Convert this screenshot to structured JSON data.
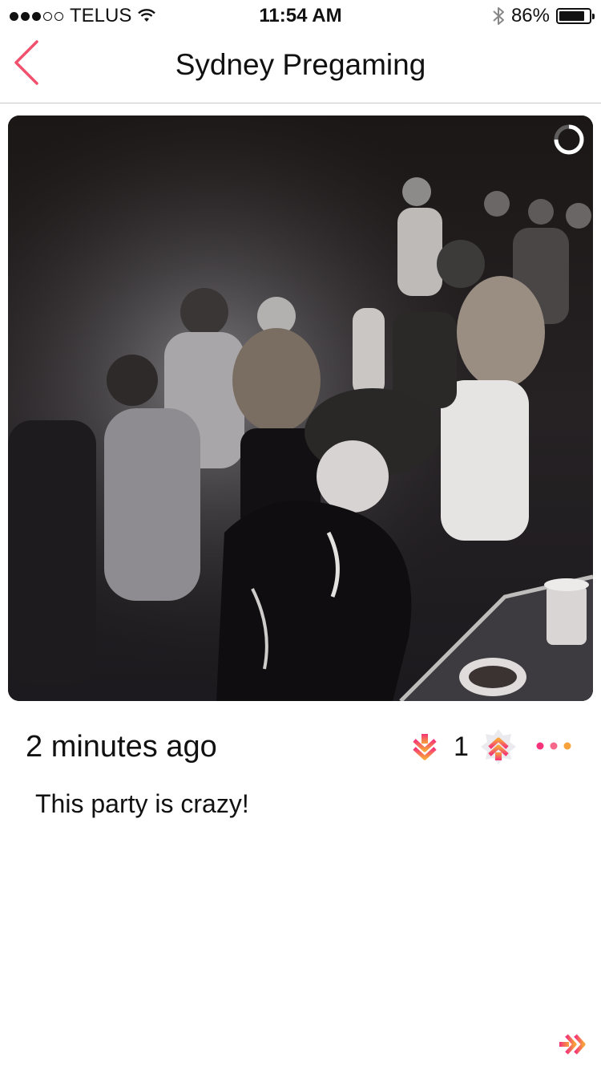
{
  "status_bar": {
    "carrier": "TELUS",
    "signal_bars_filled": 3,
    "signal_bars_total": 5,
    "time": "11:54 AM",
    "battery_percent": "86%",
    "battery_level": 0.86
  },
  "nav": {
    "title": "Sydney Pregaming",
    "back_icon": "chevron-left-icon",
    "accent_color": "#f0506e"
  },
  "post": {
    "photo_description_icon": "party-photo",
    "timestamp": "2 minutes ago",
    "vote_count": "1",
    "caption": "This party is crazy!",
    "gradient_colors": [
      "#f5327a",
      "#f7a23b"
    ]
  },
  "icons": {
    "downvote": "downvote-icon",
    "upvote": "upvote-icon",
    "more": "more-icon",
    "forward": "forward-icon",
    "loading": "loading-ring-icon"
  }
}
